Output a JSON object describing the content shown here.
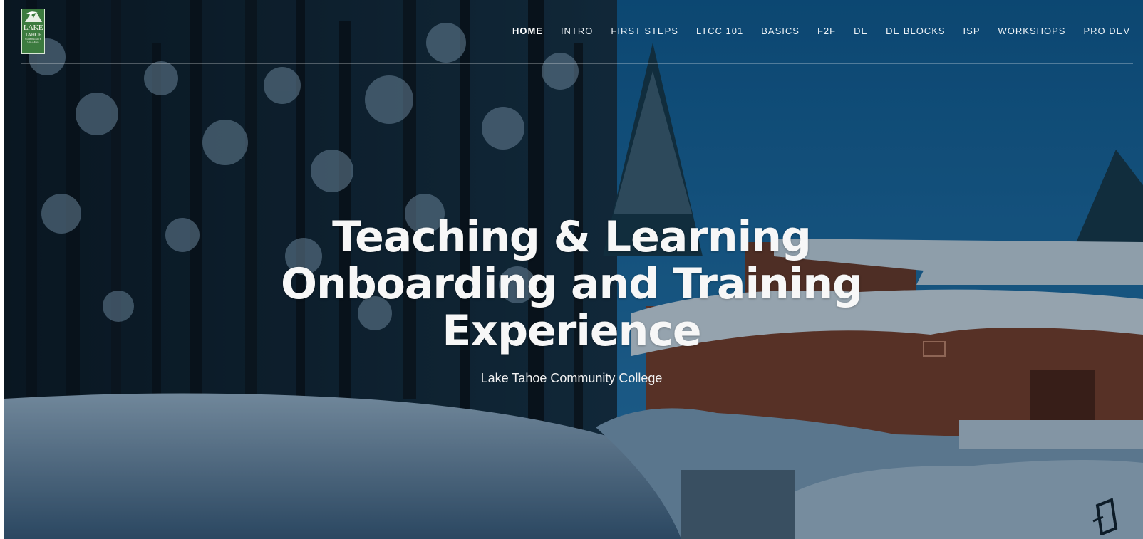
{
  "logo": {
    "line1": "LAKE",
    "line2": "TAHOE",
    "line3": "COMMUNITY COLLEGE",
    "icon": "eagle-mountain-logo"
  },
  "nav": {
    "items": [
      {
        "label": "HOME",
        "active": true
      },
      {
        "label": "INTRO",
        "active": false
      },
      {
        "label": "FIRST STEPS",
        "active": false
      },
      {
        "label": "LTCC 101",
        "active": false
      },
      {
        "label": "BASICS",
        "active": false
      },
      {
        "label": "F2F",
        "active": false
      },
      {
        "label": "DE",
        "active": false
      },
      {
        "label": "DE BLOCKS",
        "active": false
      },
      {
        "label": "ISP",
        "active": false
      },
      {
        "label": "WORKSHOPS",
        "active": false
      },
      {
        "label": "PRO DEV",
        "active": false
      }
    ]
  },
  "hero": {
    "title_lines": [
      "Teaching & Learning",
      "Onboarding and Training",
      "Experience"
    ],
    "subtitle": "Lake Tahoe Community College"
  },
  "colors": {
    "sky": "#1a6aa2",
    "snow": "#c7d9e8",
    "building": "#8a4a33",
    "logo_green": "#3c7b3f",
    "nav_text": "#eef3f7"
  }
}
